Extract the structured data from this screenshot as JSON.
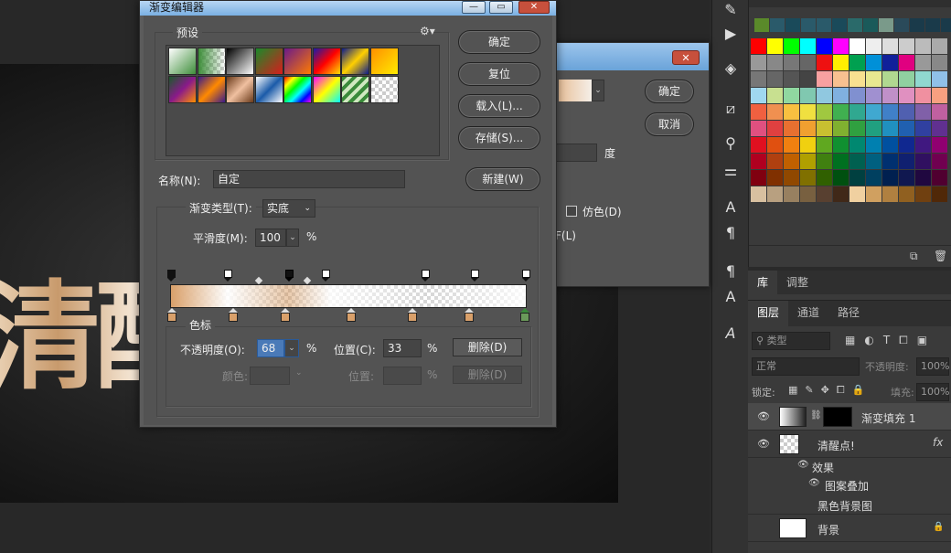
{
  "canvas": {
    "text_visible": "清醒"
  },
  "main_dialog": {
    "title": "渐变编辑器",
    "presets_label": "预设",
    "buttons": {
      "ok": "确定",
      "reset": "复位",
      "load": "载入(L)...",
      "save": "存储(S)...",
      "new": "新建(W)"
    },
    "name_label": "名称(N):",
    "name_value": "自定",
    "gradient_type_label": "渐变类型(T):",
    "gradient_type_value": "实底",
    "smoothness_label": "平滑度(M):",
    "smoothness_value": "100",
    "percent": "%",
    "stops_label": "色标",
    "opacity_label": "不透明度(O):",
    "opacity_value": "68",
    "location_label": "位置(C):",
    "location_value": "33",
    "delete_label": "删除(D)",
    "color_label": "颜色:",
    "location2_label": "位置:",
    "delete2_label": "删除(D)",
    "presets": [
      {
        "colors": [
          "#ffffff",
          "#3e8e3a"
        ]
      },
      {
        "colors": [
          "#3e8e3a",
          "transparent"
        ]
      },
      {
        "colors": [
          "#000000",
          "#ffffff"
        ]
      },
      {
        "colors": [
          "#1a8a2a",
          "#d81c1c"
        ]
      },
      {
        "colors": [
          "#6a1a8a",
          "#ff7a00"
        ]
      },
      {
        "colors": [
          "#1a1aa8",
          "#ff0000",
          "#ffe000"
        ]
      },
      {
        "colors": [
          "#0a1a8a",
          "#ffd000",
          "#0a1a8a"
        ]
      },
      {
        "colors": [
          "#ff9000",
          "#ffea00"
        ]
      },
      {
        "colors": [
          "#1a5a2a",
          "#8a1a8a",
          "#ff9000"
        ]
      },
      {
        "colors": [
          "#3a1a8a",
          "#ff8a00",
          "#3a1a8a"
        ]
      },
      {
        "colors": [
          "#6a3a1a",
          "#f0c0a0",
          "#6a3a1a"
        ]
      },
      {
        "colors": [
          "#ffffff",
          "#1a5aa8",
          "#ffffff"
        ]
      },
      {
        "colors": [
          "#ff0000",
          "#ffff00",
          "#00ff00",
          "#00ffff",
          "#0000ff",
          "#ff00ff"
        ]
      },
      {
        "colors": [
          "#ff00ff",
          "#ffff00",
          "#00ffff"
        ]
      },
      {
        "colors": [
          "#3a8a3a",
          "#d0e8c0",
          "#3a8a3a"
        ]
      },
      {
        "colors": [
          "transparent"
        ]
      }
    ],
    "gradient_preview": [
      "#d9a06a",
      "#ffffff"
    ]
  },
  "dialog2": {
    "ok": "确定",
    "cancel": "取消",
    "degree": "度",
    "dither": "仿色(D)",
    "f_label": "F(L)"
  },
  "toolstrip_icons": [
    "brush-tool-icon",
    "play-icon",
    "3d-cube-icon",
    "adjust-icon",
    "clone-icon",
    "sliders-icon",
    "type-icon",
    "paragraph-icon",
    "paragraph-style-icon",
    "char-style-icon",
    "glyph-icon"
  ],
  "swatches": {
    "recent": [
      "#5a8a2a",
      "#2a5a6a",
      "#1a4a5a",
      "#2a5a6a",
      "#2a5a6a",
      "#1a4a5a",
      "#2a6a6a",
      "#1a5a5a",
      "#7a9a8a",
      "#2a4a5a",
      "#1a3a4a",
      "#1a3a4a",
      "#1a3a4a"
    ],
    "grid": [
      "#ff0000",
      "#ffff00",
      "#00ff00",
      "#00ffff",
      "#0000ff",
      "#ff00ff",
      "#ffffff",
      "#eeeeee",
      "#dddddd",
      "#cccccc",
      "#bbbbbb",
      "#aaaaaa",
      "#999999",
      "#888888",
      "#777777",
      "#666666",
      "#ee1111",
      "#ffee00",
      "#00a050",
      "#0090d8",
      "#10209a",
      "#e00080",
      "#999999",
      "#888888",
      "#777777",
      "#666666",
      "#555555",
      "#444444",
      "#f8a0a0",
      "#f8c090",
      "#f8e090",
      "#e8e890",
      "#b0d890",
      "#90d0a0",
      "#90d8d0",
      "#90c0e8",
      "#a0d8f0",
      "#c8e090",
      "#90d8a0",
      "#80c8b0",
      "#90c8e0",
      "#80b0e0",
      "#8090d0",
      "#a090d0",
      "#c090c8",
      "#e090c0",
      "#f090a0",
      "#f8a080",
      "#f06040",
      "#f09050",
      "#f8c040",
      "#f0e040",
      "#a0c840",
      "#40b050",
      "#30a890",
      "#40a8d0",
      "#4080c8",
      "#5060b0",
      "#8060a8",
      "#c060a0",
      "#e05080",
      "#e04040",
      "#e87030",
      "#f0a030",
      "#c8c030",
      "#80b030",
      "#30a040",
      "#20a080",
      "#2090c0",
      "#2060b0",
      "#3040a0",
      "#603090",
      "#e01020",
      "#e05010",
      "#f08010",
      "#f0d010",
      "#60a820",
      "#109030",
      "#008870",
      "#0080b0",
      "#0050a0",
      "#102890",
      "#401880",
      "#900070",
      "#b00020",
      "#b04010",
      "#c06000",
      "#b0a000",
      "#408010",
      "#007020",
      "#006050",
      "#006080",
      "#003070",
      "#102070",
      "#301060",
      "#700050",
      "#800010",
      "#803000",
      "#904800",
      "#807000",
      "#306000",
      "#005010",
      "#004040",
      "#004060",
      "#002050",
      "#101850",
      "#200840",
      "#500030",
      "#d8c0a0",
      "#b8a080",
      "#988060",
      "#786040",
      "#584030",
      "#402818",
      "#f0d0a0",
      "#d0a060",
      "#b08040",
      "#906020",
      "#704010",
      "#502808"
    ]
  },
  "panel_tabs": {
    "library": "库",
    "adjust": "调整"
  },
  "layers": {
    "tabs": [
      "图层",
      "通道",
      "路径"
    ],
    "kind_label": "类型",
    "blend_mode": "正常",
    "opacity_label": "不透明度:",
    "opacity_value": "100%",
    "lock_label": "锁定:",
    "fill_label": "填充:",
    "fill_value": "100%",
    "rows": [
      {
        "name": "渐变填充 1",
        "selected": true
      },
      {
        "name": "清醒点!",
        "selected": false,
        "fx": "fx"
      },
      {
        "name": "效果",
        "selected": false
      },
      {
        "name": "图案叠加",
        "selected": false
      },
      {
        "name": "黑色背景图",
        "selected": false
      },
      {
        "name": "背景",
        "selected": false
      }
    ]
  }
}
